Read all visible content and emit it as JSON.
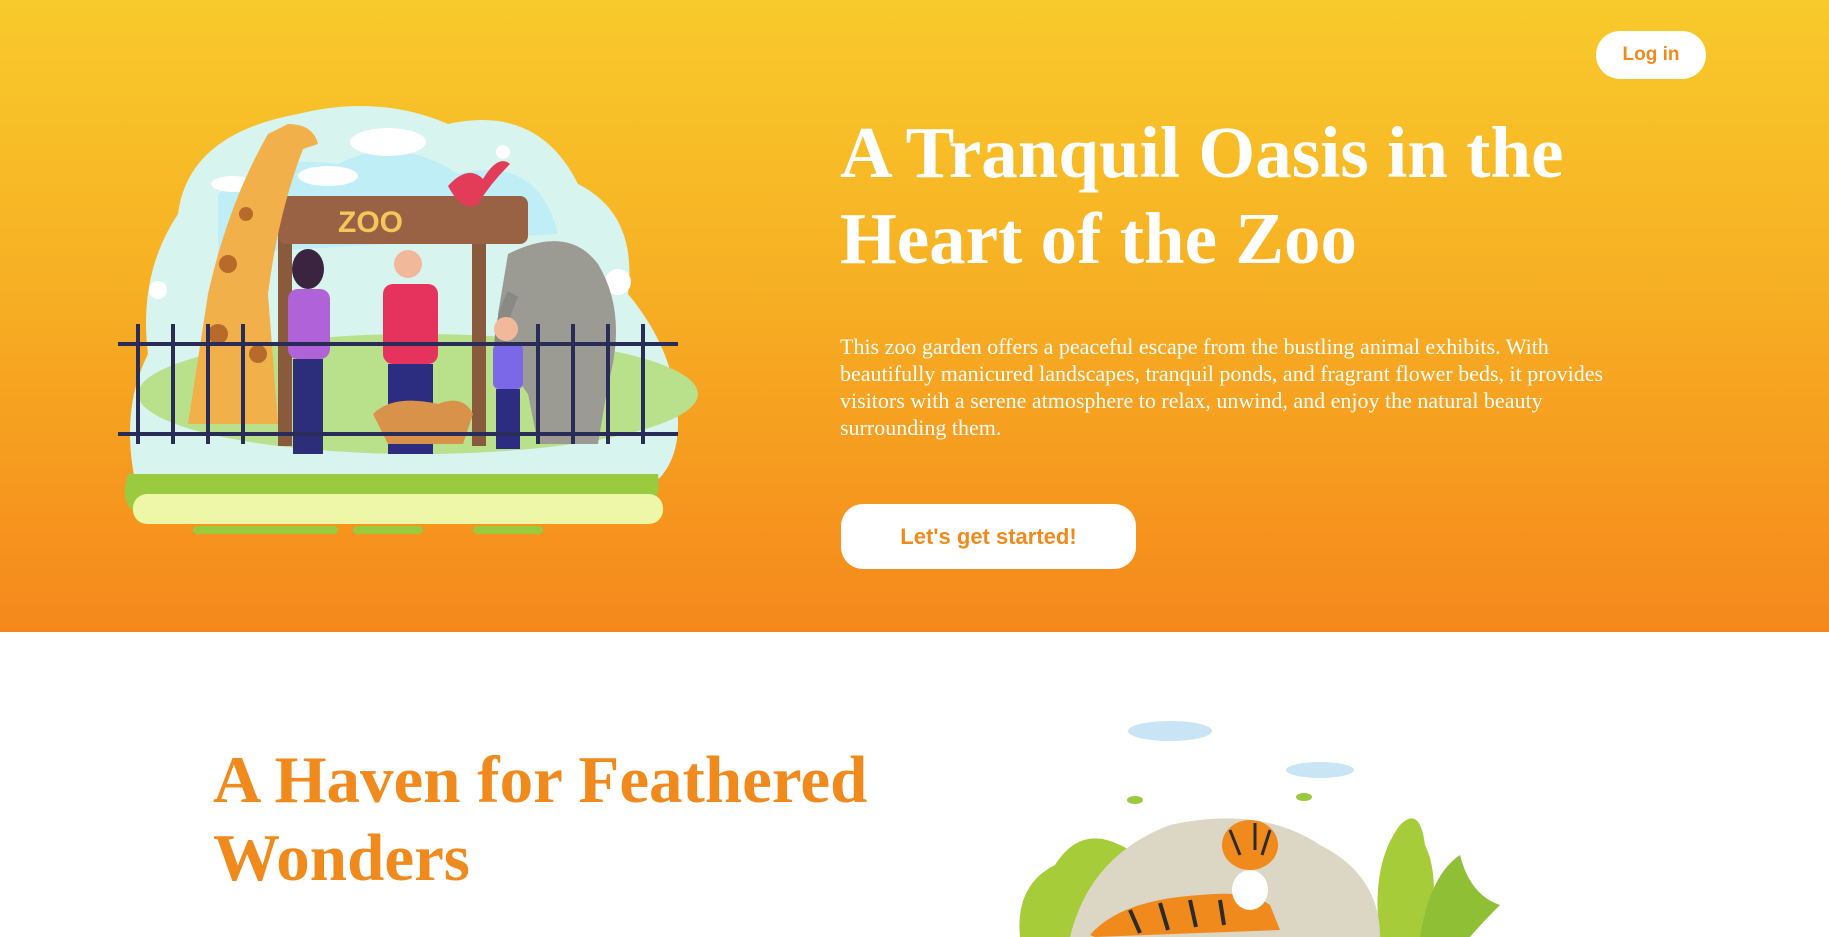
{
  "header": {
    "login_label": "Log in"
  },
  "hero": {
    "title": "A Tranquil Oasis in the Heart of the Zoo",
    "description": "This zoo garden offers a peaceful escape from the bustling animal exhibits. With beautifully manicured landscapes, tranquil ponds, and fragrant flower beds, it provides visitors with a serene atmosphere to relax, unwind, and enjoy the natural beauty surrounding them.",
    "cta_label": "Let's get started!",
    "illustration_sign": "ZOO"
  },
  "section2": {
    "title": "A Haven for Feathered Wonders"
  },
  "colors": {
    "accent": "#f08a1d",
    "hero_top": "#f8ca2c",
    "hero_bottom": "#f5881b"
  }
}
